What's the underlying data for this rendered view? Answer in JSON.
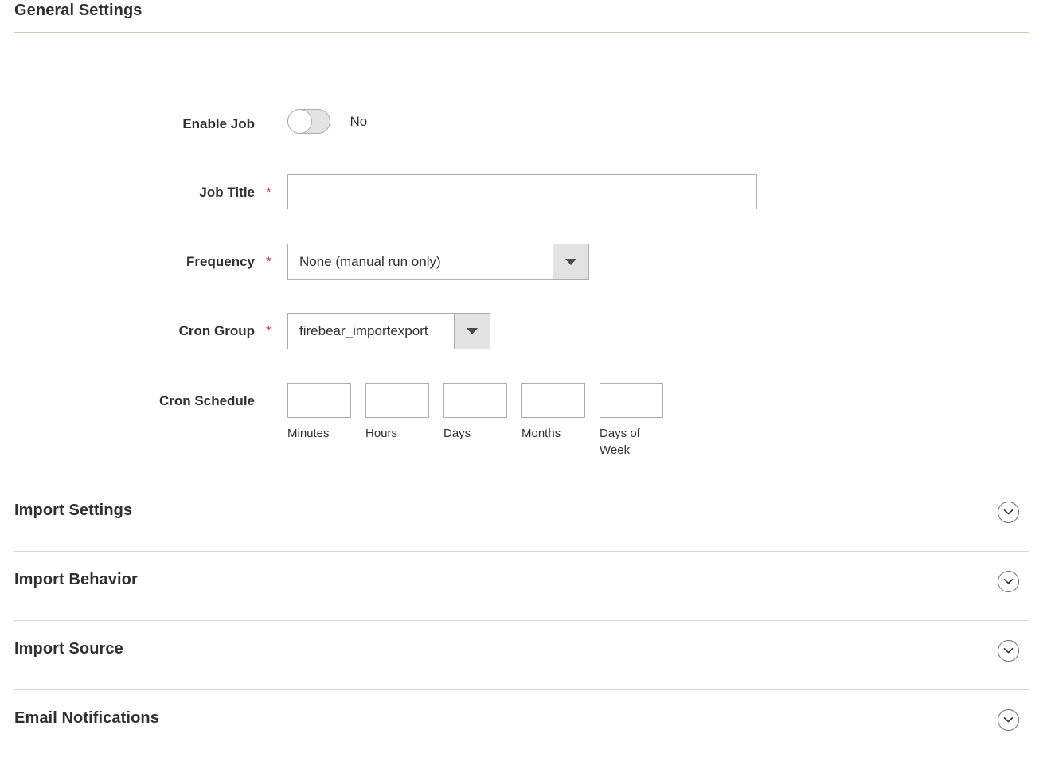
{
  "page": {
    "open_section_title": "General Settings"
  },
  "form": {
    "enable_job": {
      "label": "Enable Job",
      "value_text": "No",
      "toggle_state": "off"
    },
    "job_title": {
      "label": "Job Title",
      "required_marker": "*",
      "value": "",
      "placeholder": ""
    },
    "frequency": {
      "label": "Frequency",
      "required_marker": "*",
      "selected": "None (manual run only)"
    },
    "cron_group": {
      "label": "Cron Group",
      "required_marker": "*",
      "selected": "firebear_importexport"
    },
    "cron_schedule": {
      "label": "Cron Schedule",
      "fields": [
        {
          "caption": "Minutes",
          "value": ""
        },
        {
          "caption": "Hours",
          "value": ""
        },
        {
          "caption": "Days",
          "value": ""
        },
        {
          "caption": "Months",
          "value": ""
        },
        {
          "caption": "Days of Week",
          "value": ""
        }
      ]
    }
  },
  "sections": [
    {
      "title": "Import Settings",
      "state": "collapsed",
      "icon": "chevron-down-icon"
    },
    {
      "title": "Import Behavior",
      "state": "collapsed",
      "icon": "chevron-down-icon"
    },
    {
      "title": "Import Source",
      "state": "collapsed",
      "icon": "chevron-down-icon"
    },
    {
      "title": "Email Notifications",
      "state": "collapsed",
      "icon": "chevron-down-icon"
    }
  ],
  "colors": {
    "text": "#303030",
    "required": "#e02b27",
    "rule_tan": "#cdc6b4",
    "rule_grey": "#d6d6d6",
    "control_border": "#adadad",
    "control_button_bg": "#e3e3e3"
  }
}
